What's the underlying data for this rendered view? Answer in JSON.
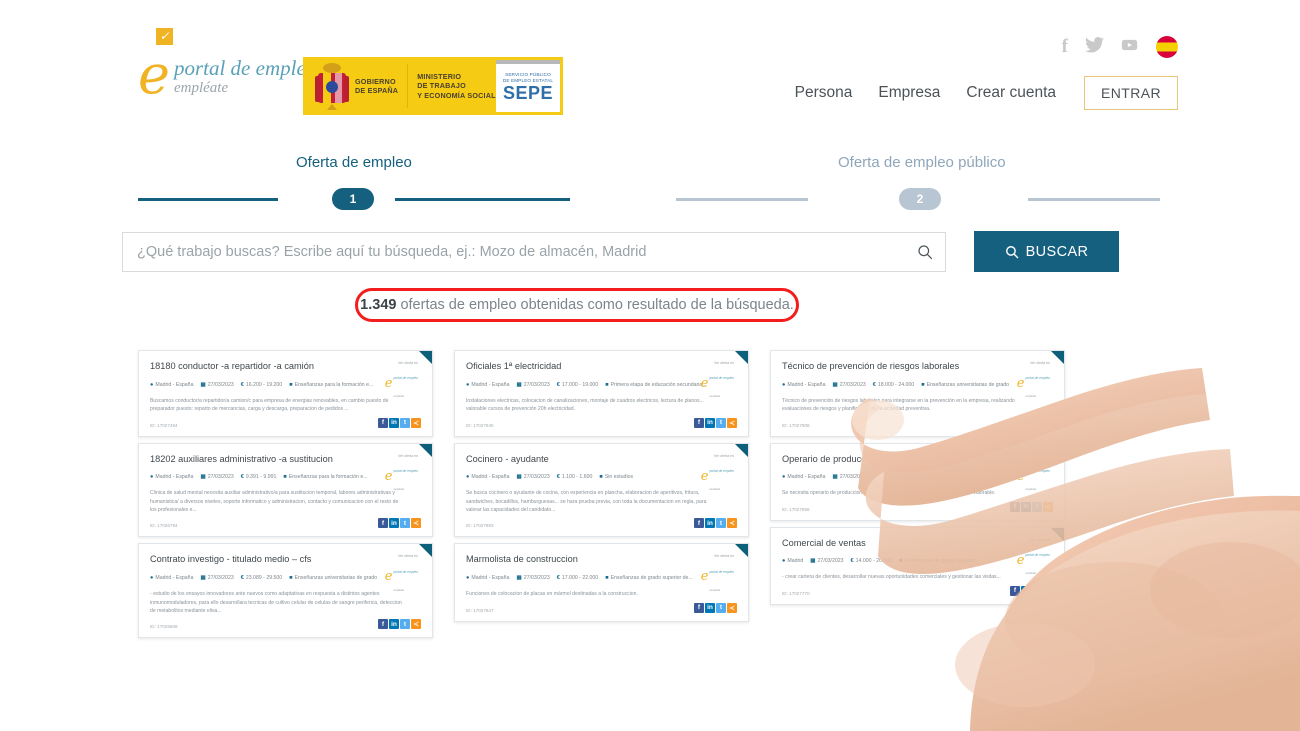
{
  "brand": {
    "logo_letter": "e",
    "check_icon": "✓",
    "title": "portal de empleo",
    "subtitle": "empléate"
  },
  "gov_logo": {
    "line1": "GOBIERNO",
    "line2": "DE ESPAÑA",
    "ministry1": "MINISTERIO",
    "ministry2": "DE TRABAJO",
    "ministry3": "Y ECONOMÍA SOCIAL",
    "sepe_line1": "SERVICIO PÚBLICO",
    "sepe_line2": "DE EMPLEO ESTATAL",
    "sepe_acronym": "SEPE"
  },
  "header": {
    "social": [
      {
        "name": "facebook-icon",
        "glyph": "f"
      },
      {
        "name": "twitter-icon",
        "glyph": "🐦"
      },
      {
        "name": "youtube-icon",
        "glyph": "▶"
      }
    ],
    "language_flag": "es-flag-icon",
    "nav": [
      {
        "label": "Persona"
      },
      {
        "label": "Empresa"
      },
      {
        "label": "Crear cuenta"
      }
    ],
    "login_button": "ENTRAR"
  },
  "stepper": {
    "steps": [
      {
        "label": "Oferta de empleo",
        "number": "1",
        "active": true,
        "color": "#15607f"
      },
      {
        "label": "Oferta de empleo público",
        "number": "2",
        "active": false,
        "color": "#b8c6d4"
      }
    ]
  },
  "search": {
    "placeholder": "¿Qué trabajo buscas? Escribe aquí tu búsqueda, ej.: Mozo de almacén, Madrid",
    "value": "",
    "input_icon": "search-icon",
    "button_label": "BUSCAR",
    "button_icon": "search-icon",
    "button_color": "#15607f"
  },
  "results_banner": {
    "count": "1.349",
    "text": "ofertas de empleo obtenidas como resultado de la búsqueda.",
    "highlight_color": "#f41d1d"
  },
  "card_badge": {
    "label": "Ver oferta en",
    "logo_letter": "e",
    "logo_title": "portal de empleo",
    "logo_sub": "empléate"
  },
  "share_icons": [
    {
      "name": "facebook-share-icon",
      "glyph": "f",
      "class": "s-fb"
    },
    {
      "name": "linkedin-share-icon",
      "glyph": "in",
      "class": "s-in"
    },
    {
      "name": "twitter-share-icon",
      "glyph": "t",
      "class": "s-tw"
    },
    {
      "name": "share-icon",
      "glyph": "≺",
      "class": "s-sh"
    }
  ],
  "columns": [
    {
      "cards": [
        {
          "title": "18180 conductor -a repartidor -a camión",
          "location": "Madrid - España",
          "date": "27/03/2023",
          "salary": "16.200 - 19.200",
          "requirement": "Enseñanzas para la formación e...",
          "description": "Buscamos conductor/a repartidor/a camion/c para empresa de energias renovables, en cambio puesto de preparador puesto: reparto de mercancias, carga y descarga, preparacion de pedidos ...",
          "id": "ID: 17027494"
        },
        {
          "title": "18202 auxiliares administrativo -a sustitucion",
          "location": "Madrid - España",
          "date": "27/03/2023",
          "salary": "9.391 - 9.991",
          "requirement": "Enseñanzas para la formación e...",
          "description": "Clinica de salud mental necesita auxiliar administrativo/a para sustitucion temporal, labores administrativas y humanistica/ a diversos niveles, soporte informatico y administracion, contacto y comunicacion con el resto de los profesionales e...",
          "id": "ID: 17026794"
        },
        {
          "title": "Contrato investigo - titulado medio – cfs",
          "location": "Madrid - España",
          "date": "27/03/2023",
          "salary": "23.089 - 29.500",
          "requirement": "Enseñanzas universitarias de grado",
          "description": "- estudio de los ensayos innovadores ante nuevos como adaptativas en respuesta a distintos agentes inmunomoduladores, para ello desarrollara tecnicas de cultivo celular de celulas de sangre periferica, deteccion de metabolitos mediante elisa...",
          "id": "ID: 17025606"
        }
      ]
    },
    {
      "cards": [
        {
          "title": "Oficiales 1ª electricidad",
          "location": "Madrid - España",
          "date": "27/03/2023",
          "salary": "17.000 - 19.000",
          "requirement": "Primera etapa de educación secundaria...",
          "description": "Instalaciones electricas, colocacion de canalizaciones, montaje de cuadros electricos, lectura de planos... valorable cursos de prevención 20h electricidad.",
          "id": "ID: 17027945"
        },
        {
          "title": "Cocinero - ayudante",
          "location": "Madrid - España",
          "date": "27/03/2023",
          "salary": "1.100 - 1.600",
          "requirement": "Sin estudios",
          "description": "Se busca cocinero o ayudante de cocina, con experiencia en plancha, elaboracion de aperitivos, fritura, sandwiches, bocadillos, hamburguesas... se hara prueba previa, con toda la documentacion en regla, para valorar las capacidades del candidato...",
          "id": "ID: 17027893"
        },
        {
          "title": "Marmolista de construccion",
          "location": "Madrid - España",
          "date": "27/03/2023",
          "salary": "17.000 - 22.000",
          "requirement": "Enseñanzas de grado superior de...",
          "description": "Funciones de colocacion de placas en mármol destinadas a la construccion.",
          "id": "ID: 17027847"
        }
      ]
    },
    {
      "cards": [
        {
          "title": "Técnico de prevención de riesgos laborales",
          "location": "Madrid - España",
          "date": "27/03/2023",
          "salary": "18.000 - 24.000",
          "requirement": "Enseñanzas universitarias de grado",
          "description": "Técnico de prevención de riesgos laborales para integrarse en la prevención en la empresa, realizando evaluaciones de riesgos y planificación de la actividad preventiva.",
          "id": "ID: 17027908"
        },
        {
          "title": "Operario de produccion",
          "location": "Madrid - España",
          "date": "27/03/2023",
          "salary": "15.000 - 18.000",
          "requirement": "Enseñanzas para la formación e...",
          "description": "Se necesita operario de produccion para empresa del sector, con experiencia previa valorable.",
          "id": "ID: 17027856"
        },
        {
          "title": "Comercial de ventas",
          "location": "Madrid",
          "date": "27/03/2023",
          "salary": "14.000 - 20.000",
          "requirement": "Enseñanzas de grado superior",
          "description": "- crear cartera de clientes, desarrollar nuevas oportunidades comerciales y gestionar las visitas...",
          "id": "ID: 17027770"
        }
      ]
    }
  ]
}
